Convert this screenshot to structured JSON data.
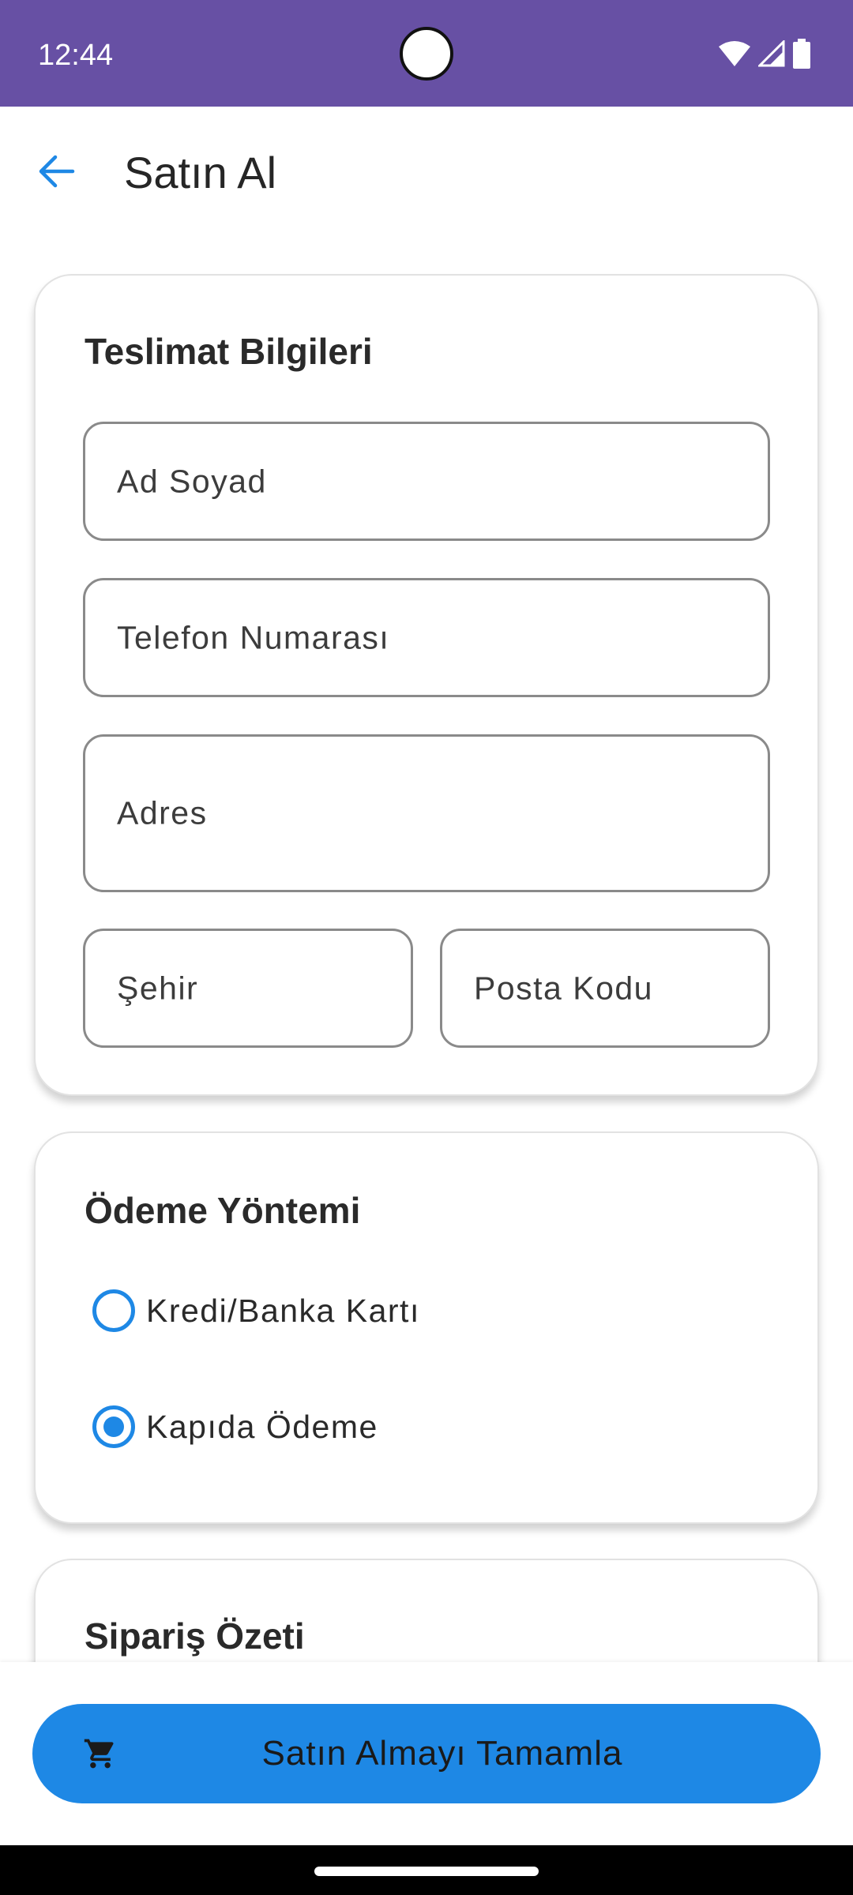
{
  "status_bar": {
    "time": "12:44",
    "icons": [
      "wifi-icon",
      "signal-icon",
      "battery-icon"
    ],
    "background": "#6750a4"
  },
  "app_bar": {
    "title": "Satın Al",
    "back_icon": "arrow-back-icon",
    "accent": "#1e88e5"
  },
  "delivery": {
    "title": "Teslimat Bilgileri",
    "fields": {
      "name": {
        "placeholder": "Ad Soyad",
        "value": ""
      },
      "phone": {
        "placeholder": "Telefon Numarası",
        "value": ""
      },
      "address": {
        "placeholder": "Adres",
        "value": ""
      },
      "city": {
        "placeholder": "Şehir",
        "value": ""
      },
      "postal_code": {
        "placeholder": "Posta Kodu",
        "value": ""
      }
    }
  },
  "payment": {
    "title": "Ödeme Yöntemi",
    "options": [
      {
        "label": "Kredi/Banka Kartı",
        "selected": false
      },
      {
        "label": "Kapıda Ödeme",
        "selected": true
      }
    ]
  },
  "summary": {
    "title": "Sipariş Özeti"
  },
  "actions": {
    "complete_label": "Satın Almayı Tamamla",
    "complete_icon": "cart-icon",
    "button_color": "#1e88e5"
  }
}
